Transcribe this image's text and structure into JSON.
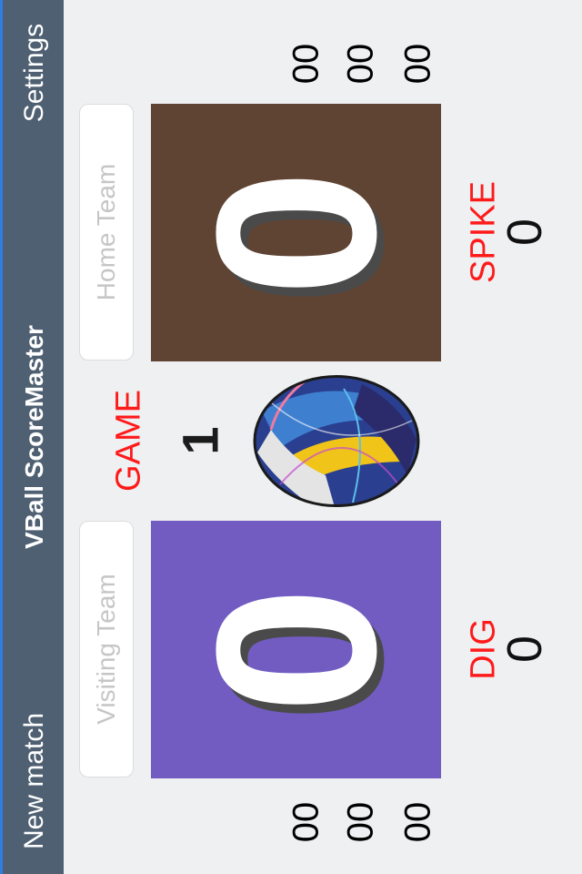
{
  "header": {
    "new_match": "New match",
    "title": "VBall ScoreMaster",
    "settings": "Settings"
  },
  "home": {
    "placeholder": "Home Team",
    "score": "0",
    "sets": [
      "00",
      "00",
      "00"
    ],
    "stat_label": "SPIKE",
    "stat_value": "0",
    "color": "#5f4433"
  },
  "visiting": {
    "placeholder": "Visiting Team",
    "score": "0",
    "sets": [
      "00",
      "00",
      "00"
    ],
    "stat_label": "DIG",
    "stat_value": "0",
    "color": "#725cc2"
  },
  "game": {
    "label": "GAME",
    "number": "1"
  },
  "icons": {
    "ball": "volleyball-icon"
  }
}
